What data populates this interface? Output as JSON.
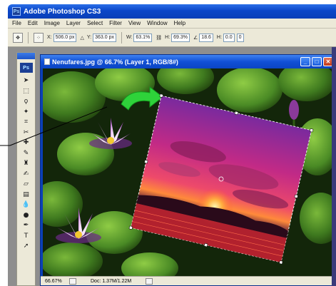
{
  "app": {
    "title": "Adobe Photoshop CS3",
    "logo_text": "Ps"
  },
  "menubar": {
    "items": [
      "File",
      "Edit",
      "Image",
      "Layer",
      "Select",
      "Filter",
      "View",
      "Window",
      "Help"
    ]
  },
  "options": {
    "x_label": "X:",
    "x_value": "506.0 px",
    "y_label": "Y:",
    "y_value": "363.0 px",
    "w_label": "W:",
    "w_value": "63.1%",
    "h_label": "H:",
    "h_value": "69.3%",
    "angle_value": "18.6",
    "h_skew_label": "H:",
    "h_skew_value": "0.0",
    "v_skew_value": "0"
  },
  "document": {
    "title": "Nenufares.jpg @ 66.7% (Layer 1, RGB/8#)",
    "status_zoom": "66.67%",
    "status_info": "Doc: 1.37M/1.22M"
  },
  "tools": {
    "badge": "Ps",
    "icons": [
      "move-tool",
      "marquee-tool",
      "lasso-tool",
      "magic-wand-tool",
      "crop-tool",
      "slice-tool",
      "healing-tool",
      "brush-tool",
      "clone-stamp-tool",
      "history-brush-tool",
      "eraser-tool",
      "gradient-tool",
      "blur-tool",
      "dodge-tool",
      "pen-tool",
      "type-tool",
      "path-select-tool"
    ]
  },
  "colors": {
    "title_blue": "#0b46c8",
    "chrome": "#ece9d8",
    "sunset_pink": "#d0296e",
    "leaf_green": "#3f7a1f"
  }
}
